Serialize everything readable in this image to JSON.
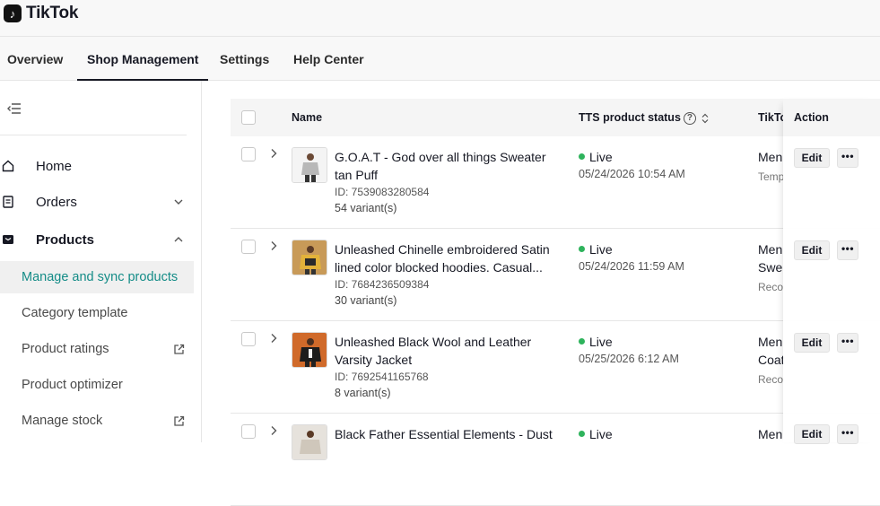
{
  "app": {
    "title": "TikTok",
    "logo_icon": "tiktok-logo-icon"
  },
  "nav": {
    "tabs": [
      {
        "label": "Overview",
        "active": false
      },
      {
        "label": "Shop Management",
        "active": true
      },
      {
        "label": "Settings",
        "active": false
      },
      {
        "label": "Help Center",
        "active": false
      }
    ]
  },
  "sidebar": {
    "items": [
      {
        "label": "Home",
        "icon": "home-icon"
      },
      {
        "label": "Orders",
        "icon": "orders-icon",
        "chevron": "down"
      },
      {
        "label": "Products",
        "icon": "products-icon",
        "chevron": "up"
      }
    ],
    "sub_items": [
      {
        "label": "Manage and sync products",
        "active": true
      },
      {
        "label": "Category template"
      },
      {
        "label": "Product ratings",
        "external": true
      },
      {
        "label": "Product optimizer"
      },
      {
        "label": "Manage stock",
        "external": true
      }
    ]
  },
  "table": {
    "headers": {
      "name": "Name",
      "status": "TTS product status",
      "category": "TikTo",
      "action": "Action"
    },
    "rows": [
      {
        "name": "G.O.A.T - God over all things Sweater tan Puff",
        "id": "ID: 7539083280584",
        "variants": "54 variant(s)",
        "status": "Live",
        "date": "05/24/2026 10:54 AM",
        "cat1": "Men",
        "cat2": "",
        "cat_sub": "Temp"
      },
      {
        "name": "Unleashed Chinelle embroidered Satin lined color blocked hoodies. Casual...",
        "id": "ID: 7684236509384",
        "variants": "30 variant(s)",
        "status": "Live",
        "date": "05/24/2026 11:59 AM",
        "cat1": "Men",
        "cat2": "Swe",
        "cat_sub": "Reco"
      },
      {
        "name": "Unleashed Black Wool and Leather Varsity Jacket",
        "id": "ID: 7692541165768",
        "variants": "8 variant(s)",
        "status": "Live",
        "date": "05/25/2026 6:12 AM",
        "cat1": "Men",
        "cat2": "Coat",
        "cat_sub": "Reco"
      },
      {
        "name": "Black Father Essential Elements - Dust",
        "id": "",
        "variants": "",
        "status": "Live",
        "date": "",
        "cat1": "Men",
        "cat2": "",
        "cat_sub": ""
      }
    ],
    "edit_label": "Edit",
    "more_label": "•••"
  }
}
